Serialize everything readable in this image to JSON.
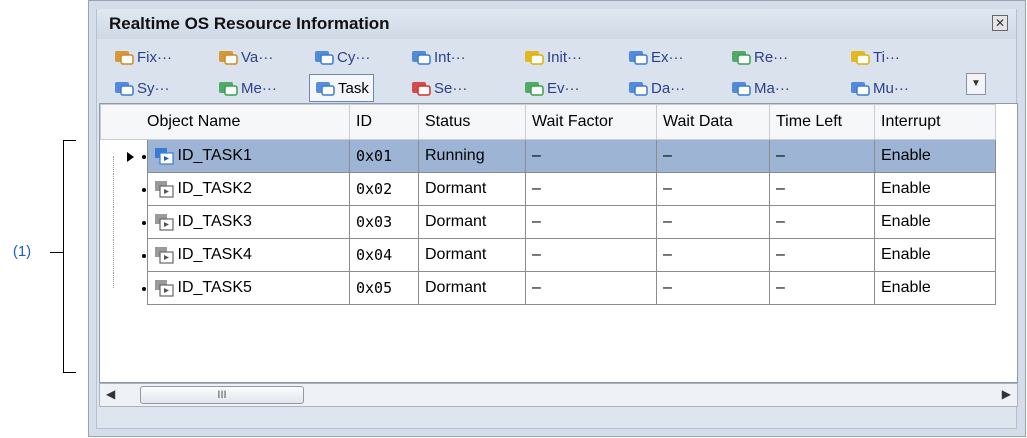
{
  "callout": {
    "label": "(1)"
  },
  "window": {
    "title": "Realtime OS Resource Information",
    "close_glyph": "✕"
  },
  "toolbar": {
    "row1": [
      {
        "label": "Fix···",
        "icon": "fixed-memory-pool-icon",
        "color": "#d18a1c"
      },
      {
        "label": "Va···",
        "icon": "variable-memory-pool-icon",
        "color": "#d18a1c"
      },
      {
        "label": "Cy···",
        "icon": "cyclic-handler-icon",
        "color": "#3a7bd5"
      },
      {
        "label": "Int···",
        "icon": "interrupt-handler-icon",
        "color": "#3a7bd5"
      },
      {
        "label": "Init···",
        "icon": "initialize-routine-icon",
        "color": "#e0b000"
      },
      {
        "label": "Ex···",
        "icon": "exception-handler-icon",
        "color": "#3a7bd5"
      },
      {
        "label": "Re···",
        "icon": "ready-queue-icon",
        "color": "#3aa050"
      },
      {
        "label": "Ti···",
        "icon": "timer-queue-icon",
        "color": "#e0b000"
      }
    ],
    "row2": [
      {
        "label": "Sy···",
        "icon": "system-state-icon",
        "color": "#3a7bd5"
      },
      {
        "label": "Me···",
        "icon": "memory-icon",
        "color": "#3aa050"
      },
      {
        "label": "Task",
        "icon": "task-icon",
        "color": "#3a7bd5",
        "selected": true
      },
      {
        "label": "Se···",
        "icon": "semaphore-icon",
        "color": "#d03030"
      },
      {
        "label": "Ev···",
        "icon": "eventflag-icon",
        "color": "#3aa050"
      },
      {
        "label": "Da···",
        "icon": "data-queue-icon",
        "color": "#3a7bd5"
      },
      {
        "label": "Ma···",
        "icon": "mailbox-icon",
        "color": "#3a7bd5"
      },
      {
        "label": "Mu···",
        "icon": "mutex-icon",
        "color": "#3a7bd5"
      }
    ],
    "more_glyph": "▼"
  },
  "table": {
    "columns": [
      "Object Name",
      "ID",
      "Status",
      "Wait Factor",
      "Wait Data",
      "Time Left",
      "Interrupt"
    ],
    "rows": [
      {
        "name": "ID_TASK1",
        "id": "0x01",
        "status": "Running",
        "wait_factor": "–",
        "wait_data": "–",
        "time_left": "–",
        "interrupt": "Enable"
      },
      {
        "name": "ID_TASK2",
        "id": "0x02",
        "status": "Dormant",
        "wait_factor": "–",
        "wait_data": "–",
        "time_left": "–",
        "interrupt": "Enable"
      },
      {
        "name": "ID_TASK3",
        "id": "0x03",
        "status": "Dormant",
        "wait_factor": "–",
        "wait_data": "–",
        "time_left": "–",
        "interrupt": "Enable"
      },
      {
        "name": "ID_TASK4",
        "id": "0x04",
        "status": "Dormant",
        "wait_factor": "–",
        "wait_data": "–",
        "time_left": "–",
        "interrupt": "Enable"
      },
      {
        "name": "ID_TASK5",
        "id": "0x05",
        "status": "Dormant",
        "wait_factor": "–",
        "wait_data": "–",
        "time_left": "–",
        "interrupt": "Enable"
      }
    ],
    "selected_row": 0
  },
  "scrollbar": {
    "left_glyph": "◀",
    "right_glyph": "▶",
    "thumb_glyph": "III"
  },
  "colors": {
    "selection": "#9db4d4",
    "callout": "#1f5fbf",
    "panel": "#d4dde9"
  }
}
